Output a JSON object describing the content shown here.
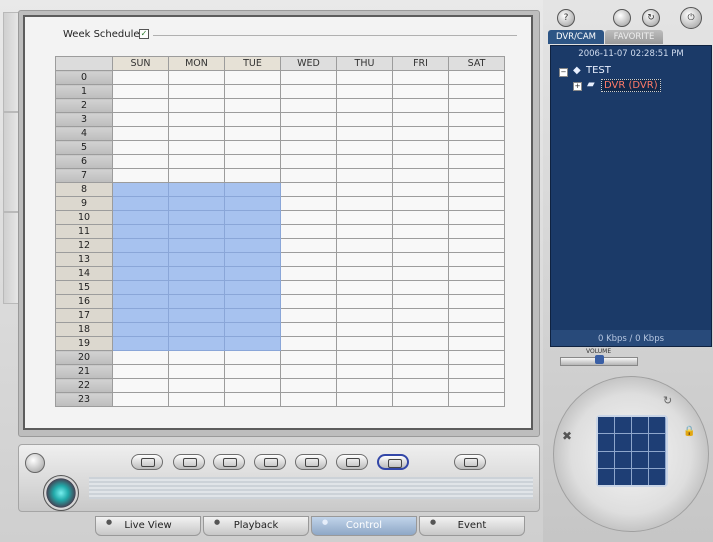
{
  "schedule": {
    "label": "Week Schedule :",
    "checked": true,
    "checkmark": "✓",
    "days": [
      "SUN",
      "MON",
      "TUE",
      "WED",
      "THU",
      "FRI",
      "SAT"
    ],
    "hours": [
      "0",
      "1",
      "2",
      "3",
      "4",
      "5",
      "6",
      "7",
      "8",
      "9",
      "10",
      "11",
      "12",
      "13",
      "14",
      "15",
      "16",
      "17",
      "18",
      "19",
      "20",
      "21",
      "22",
      "23"
    ],
    "selected_days": [
      "SUN",
      "MON",
      "TUE"
    ],
    "selected_hour_range": [
      8,
      19
    ],
    "selected_color": "#a7c2ef"
  },
  "toolbar": {
    "buttons": [
      {
        "name": "edit-button",
        "icon": "pencil-icon"
      },
      {
        "name": "link-button",
        "icon": "chain-icon"
      },
      {
        "name": "display-button",
        "icon": "monitor-icon"
      },
      {
        "name": "record-button",
        "icon": "record-icon"
      },
      {
        "name": "frame-button",
        "icon": "frame-icon"
      },
      {
        "name": "print-button",
        "icon": "printer-icon"
      },
      {
        "name": "camera-button",
        "icon": "camera-icon",
        "active": true
      },
      {
        "name": "list-button",
        "icon": "list-icon"
      }
    ]
  },
  "tabs": [
    {
      "label": "Live View",
      "active": false
    },
    {
      "label": "Playback",
      "active": false
    },
    {
      "label": "Control",
      "active": true
    },
    {
      "label": "Event",
      "active": false
    }
  ],
  "right_panel": {
    "tabs": [
      "DVR/CAM",
      "FAVORITE"
    ],
    "active_tab": "DVR/CAM",
    "datetime": "2006-11-07 02:28:51 PM",
    "tree": {
      "root": "TEST",
      "child": "DVR (DVR)"
    },
    "bandwidth": "0 Kbps / 0 Kbps",
    "volume_label": "VOLUME",
    "volume_level": 0.5,
    "top_icons": [
      "help-icon",
      "disk-icon",
      "refresh-icon",
      "power-icon"
    ],
    "help_glyph": "?",
    "refresh_glyph": "↻",
    "power_glyph": "⏻"
  },
  "colors": {
    "tree_bg": "#1b3a68",
    "active_tab": "#2d5585",
    "dvr_text": "#ff7a6a"
  }
}
